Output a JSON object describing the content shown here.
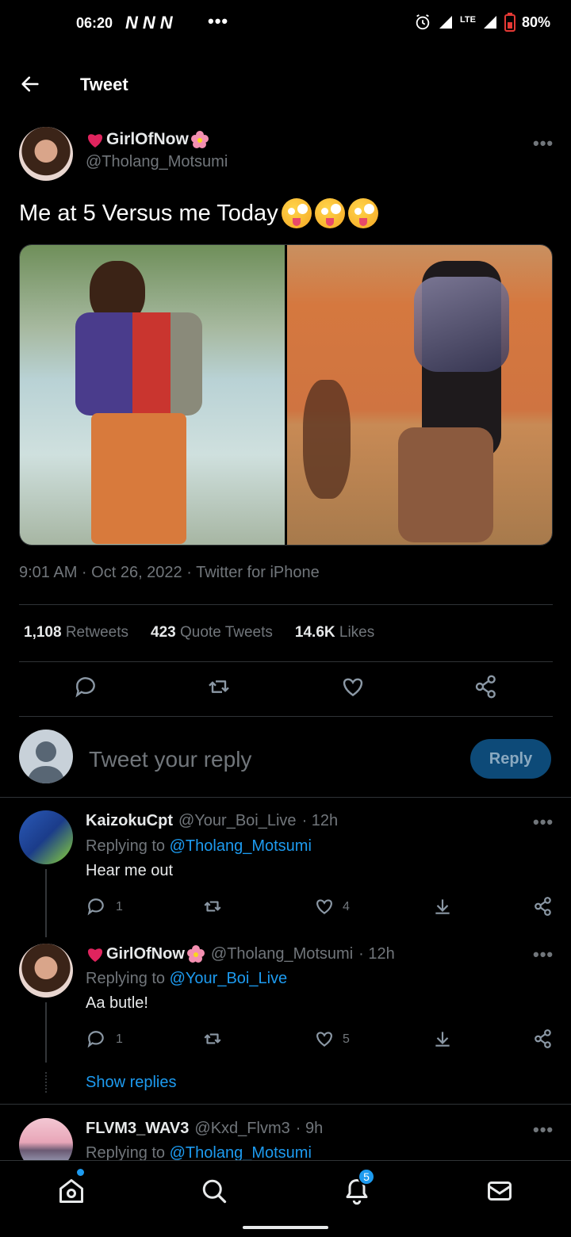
{
  "status": {
    "time": "06:20",
    "n_icons": [
      "N",
      "N",
      "N"
    ],
    "dots": "•••",
    "battery": "80%",
    "network": "LTE"
  },
  "header": {
    "title": "Tweet"
  },
  "tweet": {
    "author_name": "GirlOfNow",
    "author_handle": "@Tholang_Motsumi",
    "more": "•••",
    "text": "Me at 5 Versus me Today",
    "emoji_count": 3,
    "timestamp": "9:01 AM · Oct 26, 2022 · ",
    "client": "Twitter for iPhone",
    "stats": {
      "retweets_count": "1,108",
      "retweets_label": "Retweets",
      "quotes_count": "423",
      "quotes_label": "Quote Tweets",
      "likes_count": "14.6K",
      "likes_label": "Likes"
    }
  },
  "composer": {
    "placeholder": "Tweet your reply",
    "button": "Reply"
  },
  "replies": [
    {
      "name": "KaizokuCpt",
      "handle": "@Your_Boi_Live",
      "time": "· 12h",
      "replying_label": "Replying to",
      "replying_to": "@Tholang_Motsumi",
      "text": "Hear me out",
      "reply_count": "1",
      "like_count": "4"
    },
    {
      "name": "GirlOfNow",
      "handle": "@Tholang_Motsumi",
      "time": "· 12h",
      "replying_label": "Replying to",
      "replying_to": "@Your_Boi_Live",
      "text": "Aa butle!",
      "reply_count": "1",
      "like_count": "5",
      "show_replies": "Show replies"
    },
    {
      "name": "FLVM3_WAV3",
      "handle": "@Kxd_Flvm3",
      "time": "· 9h",
      "replying_label": "Replying to",
      "replying_to": "@Tholang_Motsumi"
    }
  ],
  "bottom_nav": {
    "items": [
      "home-icon",
      "search-icon",
      "notifications-icon",
      "messages-icon"
    ],
    "notification_badge": "5"
  },
  "colors": {
    "accent": "#1d9bf0",
    "muted": "#71767b",
    "background": "#000000",
    "heart": "#e0245e"
  }
}
